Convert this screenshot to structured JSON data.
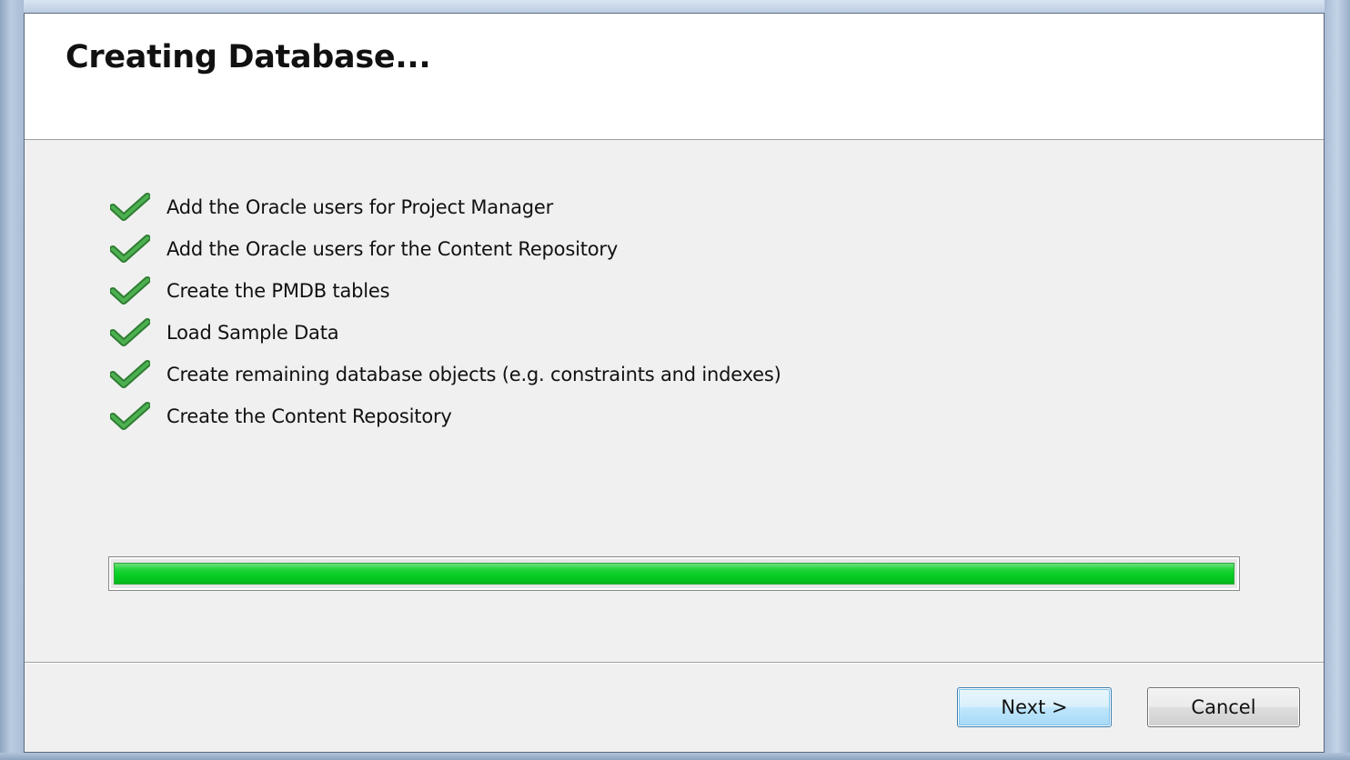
{
  "dialog": {
    "title": "Creating Database..."
  },
  "steps": [
    {
      "label": "Add the Oracle users for Project Manager",
      "status": "complete",
      "icon": "checkmark-icon"
    },
    {
      "label": "Add the Oracle users for the Content Repository",
      "status": "complete",
      "icon": "checkmark-icon"
    },
    {
      "label": "Create the PMDB tables",
      "status": "complete",
      "icon": "checkmark-icon"
    },
    {
      "label": "Load Sample Data",
      "status": "complete",
      "icon": "checkmark-icon"
    },
    {
      "label": "Create remaining database objects (e.g. constraints and indexes)",
      "status": "complete",
      "icon": "checkmark-icon"
    },
    {
      "label": "Create the Content Repository",
      "status": "complete",
      "icon": "checkmark-icon"
    }
  ],
  "progress": {
    "percent": 100,
    "color": "#06cc20"
  },
  "buttons": {
    "next_label": "Next >",
    "cancel_label": "Cancel"
  },
  "colors": {
    "check": "#2e8b2e",
    "accent": "#3c7fb1"
  }
}
